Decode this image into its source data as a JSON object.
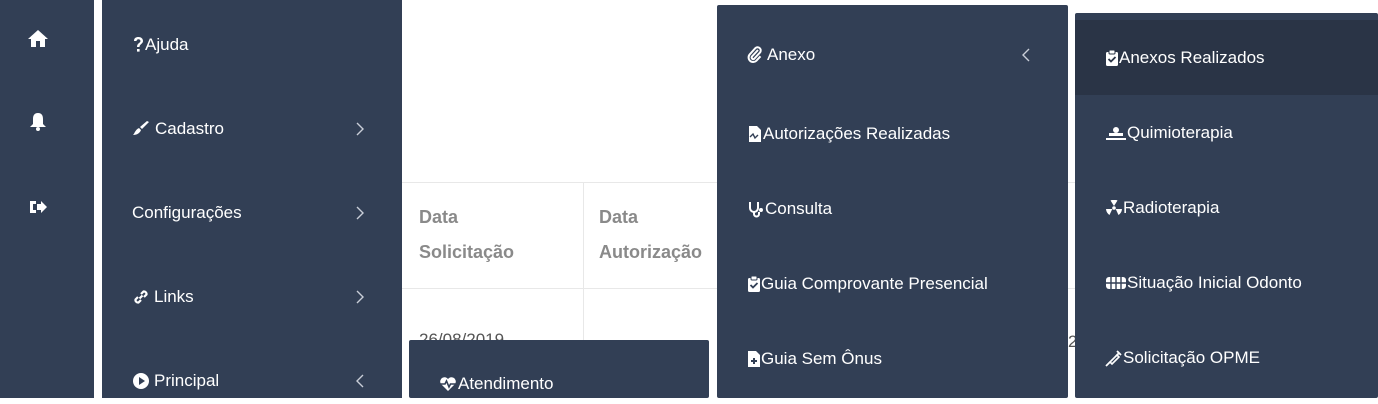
{
  "rail": {
    "icons": [
      "home-icon",
      "bell-icon",
      "sign-out-icon"
    ]
  },
  "main_menu": {
    "items": [
      {
        "label": "Ajuda",
        "icon": "question-icon",
        "has_chevron": false
      },
      {
        "label": "Cadastro",
        "icon": "brush-icon",
        "has_chevron": true,
        "chevron": "right"
      },
      {
        "label": "Configurações",
        "icon": "",
        "has_chevron": true,
        "chevron": "right"
      },
      {
        "label": "Links",
        "icon": "link-icon",
        "has_chevron": true,
        "chevron": "right"
      },
      {
        "label": "Principal",
        "icon": "play-circle-icon",
        "has_chevron": true,
        "chevron": "left"
      }
    ]
  },
  "table": {
    "headers": [
      {
        "line1": "Data",
        "line2": "Solicitação"
      },
      {
        "line1": "Data",
        "line2": "Autorização"
      }
    ],
    "rows": [
      {
        "date": "26/08/2019"
      }
    ],
    "partial_right": "2"
  },
  "principal_submenu": {
    "items": [
      {
        "label": "Atendimento",
        "icon": "heartbeat-icon"
      }
    ]
  },
  "atendimento_submenu": {
    "items": [
      {
        "label": "Anexo",
        "icon": "paperclip-icon",
        "chevron": "left"
      },
      {
        "label": "Autorizações Realizadas",
        "icon": "file-signature-icon"
      },
      {
        "label": "Consulta",
        "icon": "stethoscope-icon"
      },
      {
        "label": "Guia Comprovante Presencial",
        "icon": "clipboard-check-icon"
      },
      {
        "label": "Guia Sem Ônus",
        "icon": "file-medical-icon"
      }
    ]
  },
  "anexo_submenu": {
    "items": [
      {
        "label": "Anexos Realizados",
        "icon": "clipboard-check-icon",
        "active": true
      },
      {
        "label": "Quimioterapia",
        "icon": "procedures-icon"
      },
      {
        "label": "Radioterapia",
        "icon": "radiation-icon"
      },
      {
        "label": "Situação Inicial Odonto",
        "icon": "teeth-icon"
      },
      {
        "label": "Solicitação OPME",
        "icon": "syringe-icon"
      }
    ]
  },
  "colors": {
    "panel": "#323f55",
    "panel_active": "#2a3446",
    "text": "#ffffff",
    "header_text": "#8a8a8a"
  }
}
